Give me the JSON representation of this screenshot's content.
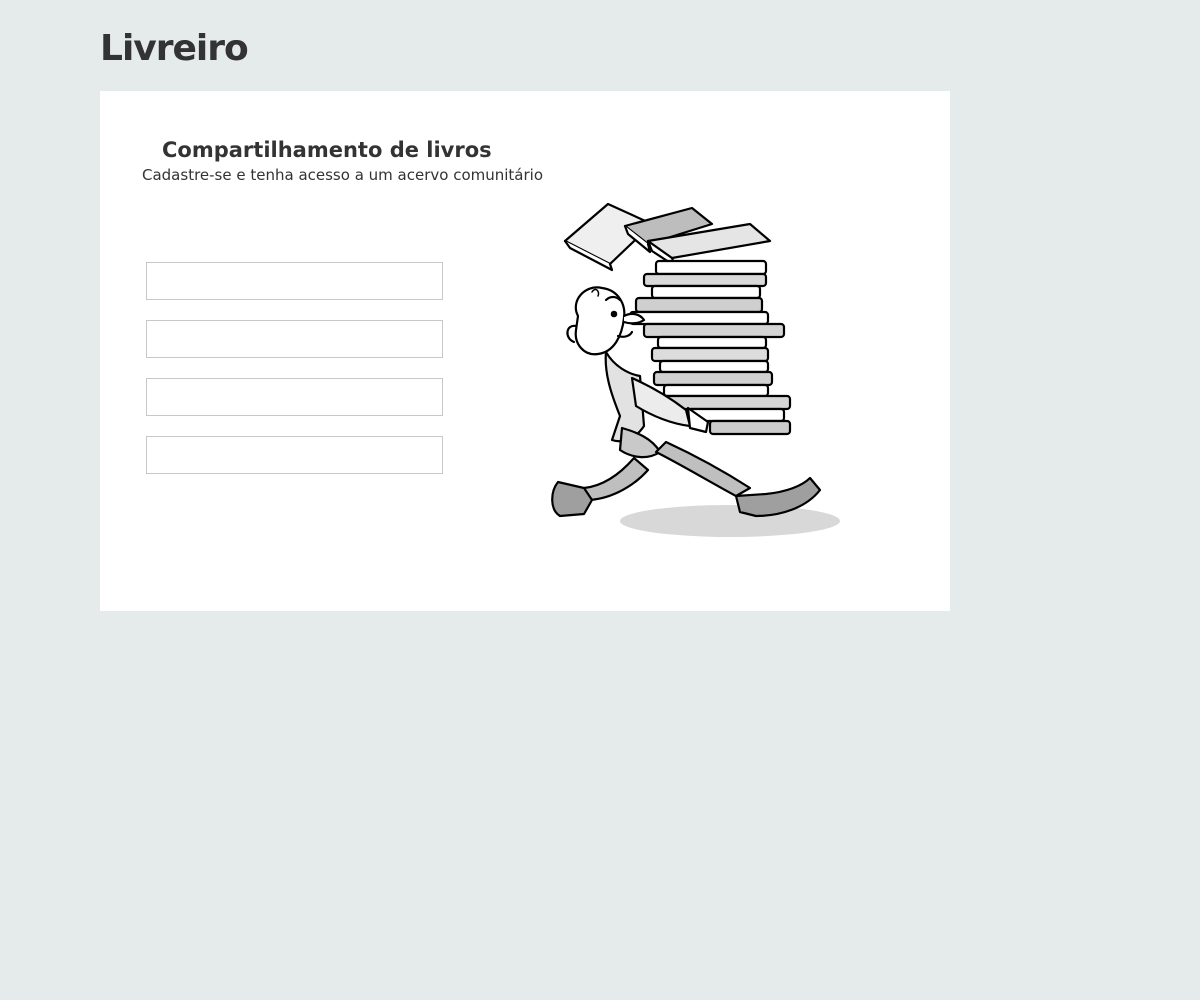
{
  "header": {
    "logo_text": "Livreiro"
  },
  "card": {
    "title": "Compartilhamento de livros",
    "subtitle": "Cadastre-se e tenha acesso a um acervo comunitário",
    "fields": [
      {
        "value": "",
        "placeholder": ""
      },
      {
        "value": "",
        "placeholder": ""
      },
      {
        "value": "",
        "placeholder": ""
      },
      {
        "value": "",
        "placeholder": ""
      }
    ],
    "illustration": "man-carrying-book-stack-illustration"
  },
  "colors": {
    "page_background": "#e5ebeb",
    "card_background": "#ffffff",
    "text": "#333333",
    "field_border": "#c8c8c8"
  }
}
